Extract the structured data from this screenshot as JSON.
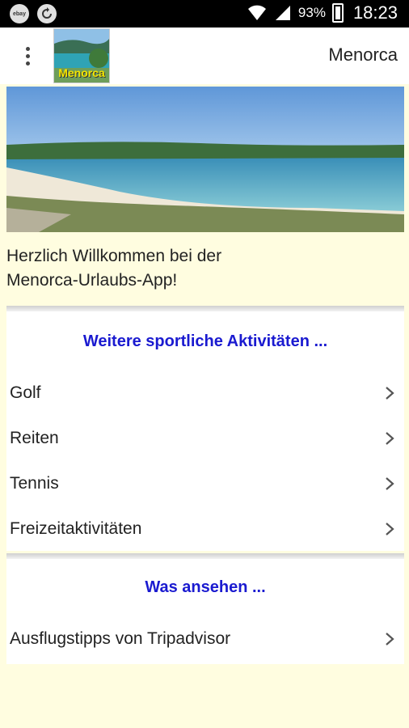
{
  "status_bar": {
    "battery_percent": "93%",
    "time": "18:23",
    "left_icons": [
      "ebay-kleinanzeigen-icon",
      "sync-icon"
    ]
  },
  "app_bar": {
    "title": "Menorca",
    "logo_text": "Menorca"
  },
  "welcome": {
    "line1": "Herzlich Willkommen bei der",
    "line2": "Menorca-Urlaubs-App!"
  },
  "sections": [
    {
      "heading": "Weitere sportliche Aktivitäten ...",
      "items": [
        {
          "label": "Golf"
        },
        {
          "label": "Reiten"
        },
        {
          "label": "Tennis"
        },
        {
          "label": "Freizeitaktivitäten"
        }
      ]
    },
    {
      "heading": "Was ansehen ...",
      "items": [
        {
          "label": "Ausflugstipps von Tripadvisor"
        }
      ]
    }
  ],
  "colors": {
    "background": "#fffde0",
    "heading": "#1a1ad0",
    "status_bar": "#000000"
  }
}
